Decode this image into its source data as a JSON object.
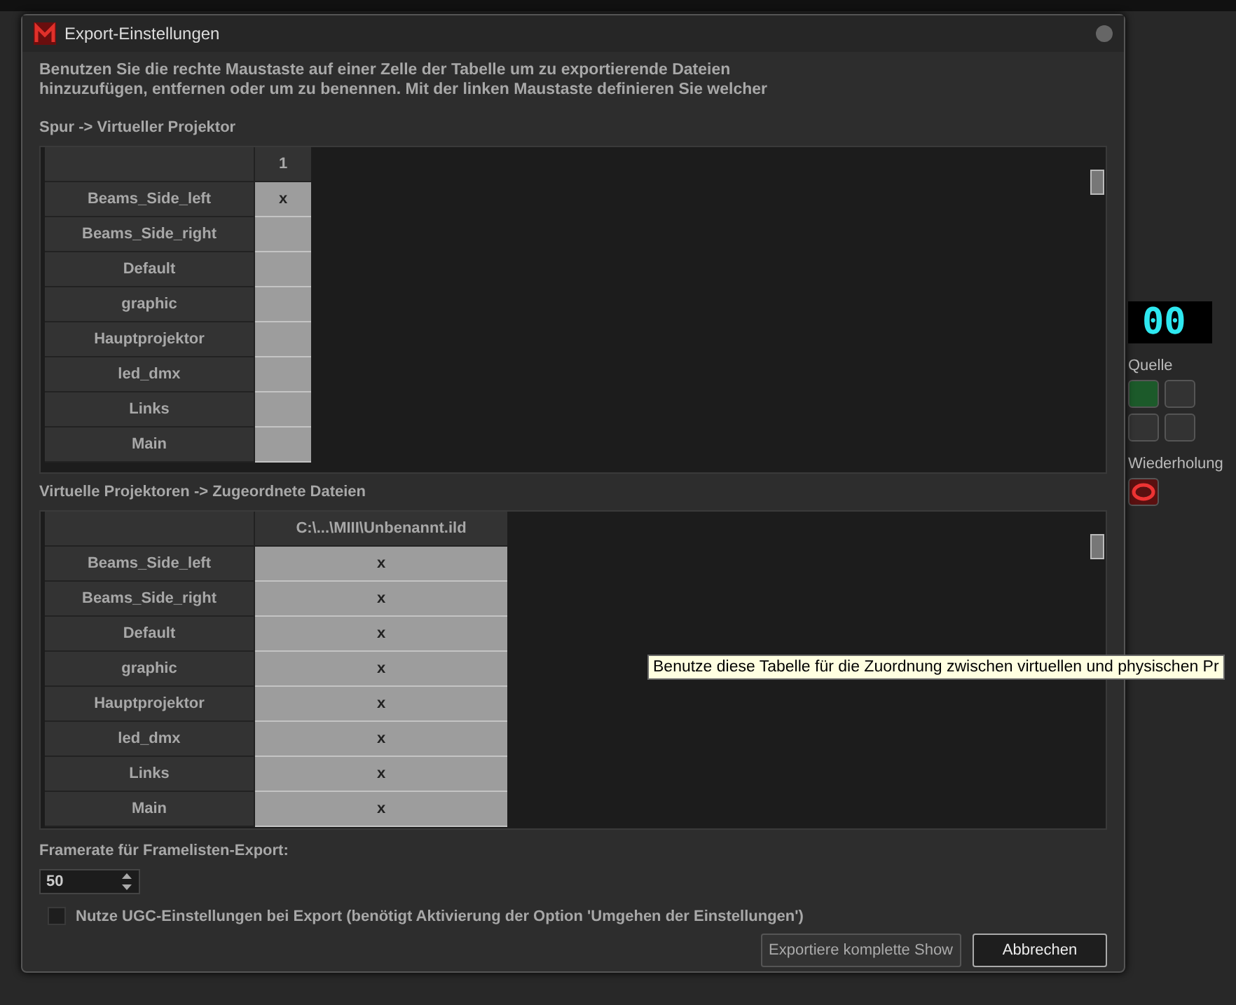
{
  "window": {
    "title": "Export-Einstellungen"
  },
  "intro": "Benutzen Sie die rechte Maustaste auf einer Zelle der Tabelle um zu exportierende Dateien hinzuzufügen, entfernen oder um zu benennen. Mit der linken Maustaste definieren Sie welcher",
  "track_table": {
    "heading": "Spur -> Virtueller Projektor",
    "columns": [
      "1"
    ],
    "rows": [
      {
        "label": "Beams_Side_left",
        "cells": [
          "x"
        ]
      },
      {
        "label": "Beams_Side_right",
        "cells": [
          ""
        ]
      },
      {
        "label": "Default",
        "cells": [
          ""
        ]
      },
      {
        "label": "graphic",
        "cells": [
          ""
        ]
      },
      {
        "label": "Hauptprojektor",
        "cells": [
          ""
        ]
      },
      {
        "label": "led_dmx",
        "cells": [
          ""
        ]
      },
      {
        "label": "Links",
        "cells": [
          ""
        ]
      },
      {
        "label": "Main",
        "cells": [
          ""
        ]
      }
    ]
  },
  "projector_table": {
    "heading": "Virtuelle Projektoren -> Zugeordnete Dateien",
    "columns": [
      "C:\\...\\MIII\\Unbenannt.ild"
    ],
    "rows": [
      {
        "label": "Beams_Side_left",
        "cells": [
          "x"
        ]
      },
      {
        "label": "Beams_Side_right",
        "cells": [
          "x"
        ]
      },
      {
        "label": "Default",
        "cells": [
          "x"
        ]
      },
      {
        "label": "graphic",
        "cells": [
          "x"
        ]
      },
      {
        "label": "Hauptprojektor",
        "cells": [
          "x"
        ]
      },
      {
        "label": "led_dmx",
        "cells": [
          "x"
        ]
      },
      {
        "label": "Links",
        "cells": [
          "x"
        ]
      },
      {
        "label": "Main",
        "cells": [
          "x"
        ]
      }
    ]
  },
  "framerate": {
    "label": "Framerate für Framelisten-Export:",
    "value": "50"
  },
  "ugc_option": {
    "label": "Nutze UGC-Einstellungen bei Export (benötigt Aktivierung der Option 'Umgehen der Einstellungen')",
    "checked": false
  },
  "buttons": [
    "Exportiere komplette Show",
    "Abbrechen"
  ],
  "tooltip": "Benutze diese Tabelle für die Zuordnung zwischen virtuellen und physischen Pr",
  "background": {
    "timecode": "00",
    "source_label": "Quelle",
    "repeat_label": "Wiederholung"
  }
}
